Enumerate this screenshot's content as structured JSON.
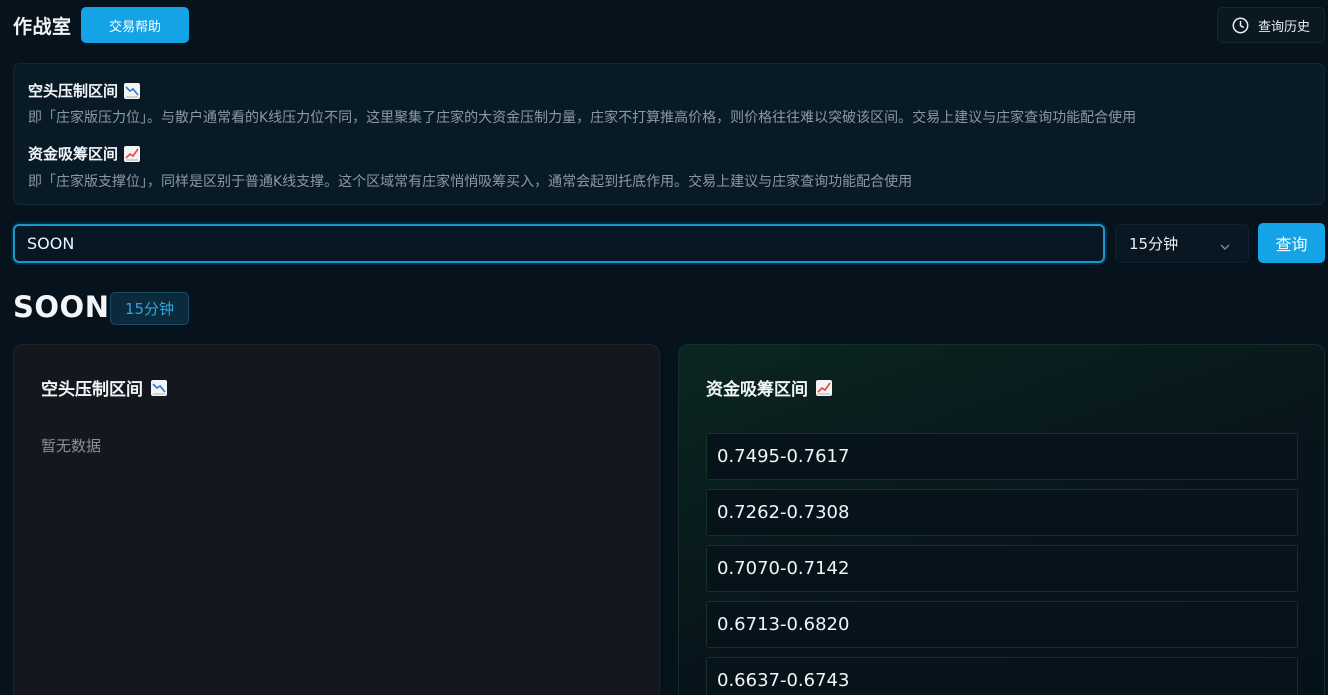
{
  "header": {
    "title": "作战室",
    "help_label": "交易帮助",
    "history_label": "查询历史"
  },
  "info": {
    "short_title": "空头压制区间",
    "short_desc": "即「庄家版压力位」。与散户通常看的K线压力位不同，这里聚集了庄家的大资金压制力量，庄家不打算推高价格，则价格往往难以突破该区间。交易上建议与庄家查询功能配合使用",
    "long_title": "资金吸筹区间",
    "long_desc": "即「庄家版支撑位」，同样是区别于普通K线支撑。这个区域常有庄家悄悄吸筹买入，通常会起到托底作用。交易上建议与庄家查询功能配合使用"
  },
  "search": {
    "value": "SOON",
    "interval": "15分钟",
    "query_label": "查询"
  },
  "result": {
    "symbol": "SOON",
    "interval_badge": "15分钟",
    "short_panel": {
      "title": "空头压制区间",
      "empty_text": "暂无数据"
    },
    "long_panel": {
      "title": "资金吸筹区间",
      "zones": [
        "0.7495-0.7617",
        "0.7262-0.7308",
        "0.7070-0.7142",
        "0.6713-0.6820",
        "0.6637-0.6743"
      ]
    }
  },
  "icons": {
    "down": "chart-decreasing-icon",
    "up": "chart-increasing-icon",
    "history": "clock-icon",
    "select": "chevron-down-icon"
  },
  "colors": {
    "accent": "#14a3e6",
    "background": "#06121c"
  }
}
